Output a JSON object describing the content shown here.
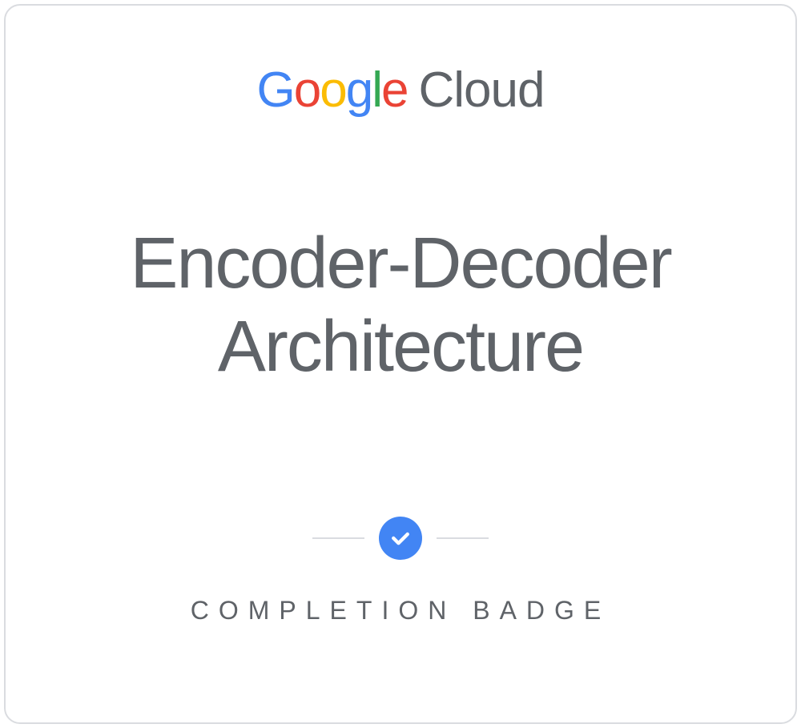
{
  "brand": {
    "g1": "G",
    "o1": "o",
    "o2": "o",
    "g2": "g",
    "l": "l",
    "e": "e",
    "cloud": "Cloud"
  },
  "course": {
    "title": "Encoder-Decoder Architecture"
  },
  "badge": {
    "label": "COMPLETION BADGE"
  }
}
